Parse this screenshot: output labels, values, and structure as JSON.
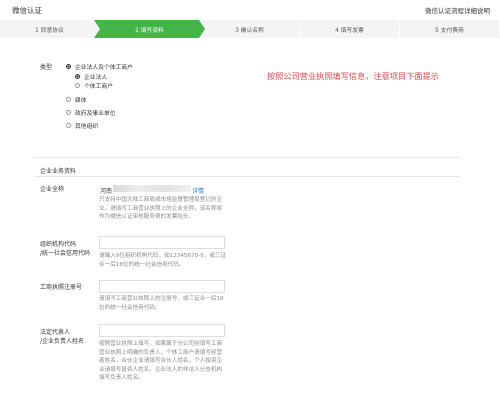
{
  "header": {
    "title": "微信认证",
    "help_link": "微信认证流程详细说明"
  },
  "steps": [
    {
      "label": "1 同意协议",
      "active": false
    },
    {
      "label": "2 填写资料",
      "active": true
    },
    {
      "label": "3 确认名称",
      "active": false
    },
    {
      "label": "4 填写发票",
      "active": false
    },
    {
      "label": "5 支付费用",
      "active": false
    }
  ],
  "type_section": {
    "label": "类型",
    "options": {
      "enterprise": "企业法人及个体工商户",
      "legal_person": "企业法人",
      "individual_business": "个体工商户",
      "media": "媒体",
      "government": "政府及事业单位",
      "other": "其他组织"
    },
    "selected": [
      "enterprise",
      "legal_person"
    ]
  },
  "notice": "按照公司营业执照填写信息，注意项目下面提示",
  "business_section": {
    "title": "企业业务资料"
  },
  "fields": {
    "company_name": {
      "label": "企业全称",
      "value": "河南",
      "link": "详情",
      "hint": "只支持中国大陆工商局或市场监督管理局登记的企业。请填写工商营业执照上的企业全称，该名称将作为微信认证审核服务费的发票抬头。"
    },
    "org_code": {
      "label_line1": "组织机构代码",
      "label_line2": "/统一社会信用代码",
      "value": "",
      "hint": "请输入9位组织机构代码，如12345678-9，或三证合一后18位的统一社会信用代码。"
    },
    "license_no": {
      "label": "工商执照注册号",
      "value": "",
      "hint": "请填写工商营业执照上的注册号，或三证合一后18位的统一社会信用代码。"
    },
    "legal_rep": {
      "label_line1": "法定代表人",
      "label_line2": "/企业负责人姓名",
      "value": "",
      "hint": "按照营业执照上填写。如果属于分公司则填写工商营业执照上明确的负责人，个体工商户请填写经营者姓名，合伙企业请填写合伙人姓名，个人独资企业请填写投资人姓名，企业法人的非法人分支机构填写负责人姓名。"
    }
  }
}
